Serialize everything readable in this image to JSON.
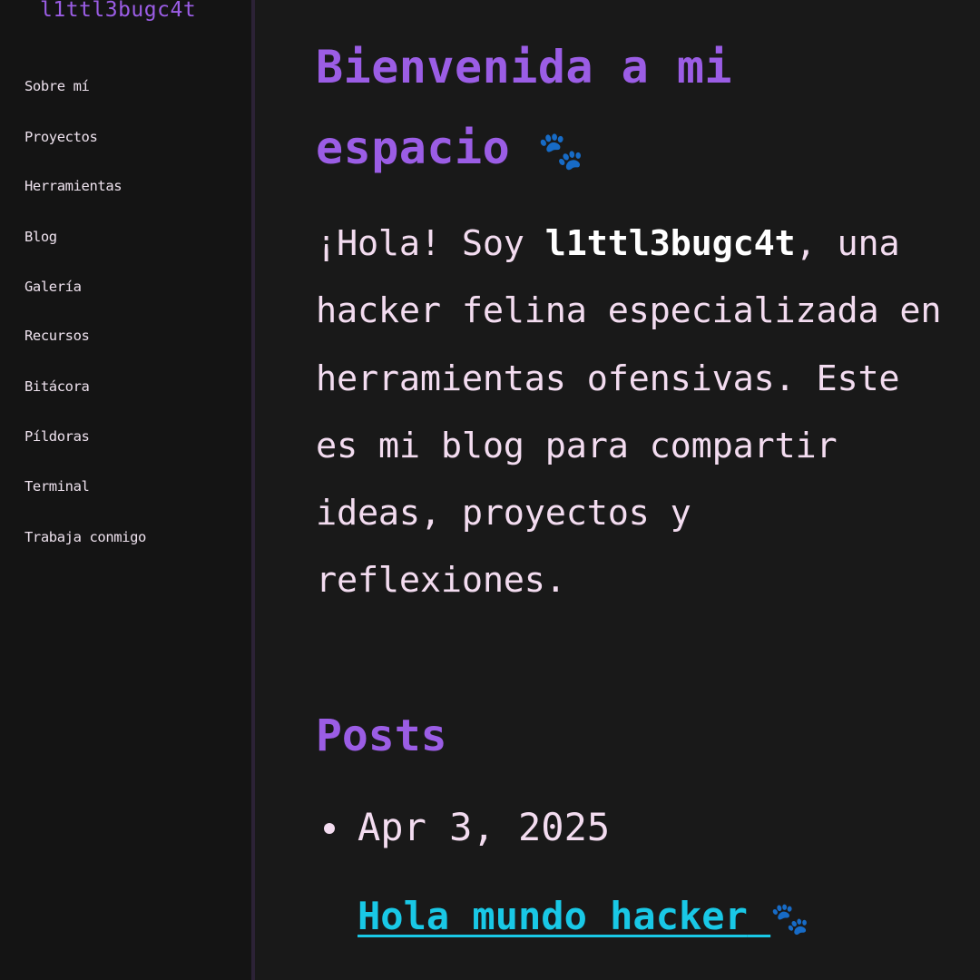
{
  "sidebar": {
    "site_title": "l1ttl3bugc4t",
    "items": [
      {
        "label": "Sobre mí"
      },
      {
        "label": "Proyectos"
      },
      {
        "label": "Herramientas"
      },
      {
        "label": "Blog"
      },
      {
        "label": "Galería"
      },
      {
        "label": "Recursos"
      },
      {
        "label": "Bitácora"
      },
      {
        "label": "Píldoras"
      },
      {
        "label": "Terminal"
      },
      {
        "label": "Trabaja conmigo"
      }
    ]
  },
  "main": {
    "title": "Bienvenida a mi espacio",
    "title_emoji": "🐾",
    "intro_start": "¡Hola! Soy ",
    "intro_name": "l1ttl3bugc4t",
    "intro_rest": ", una hacker felina especializada en herramientas ofensivas. Este es mi blog para compartir ideas, proyectos y reflexiones.",
    "posts_heading": "Posts",
    "posts": [
      {
        "date": "Apr 3, 2025",
        "title": "Hola mundo hacker",
        "title_emoji": "🐾"
      }
    ]
  },
  "colors": {
    "background": "#191919",
    "sidebar_background": "#141414",
    "accent_purple": "#9b5de5",
    "text_pink": "#f3dcf0",
    "link_cyan": "#19c8e6"
  }
}
